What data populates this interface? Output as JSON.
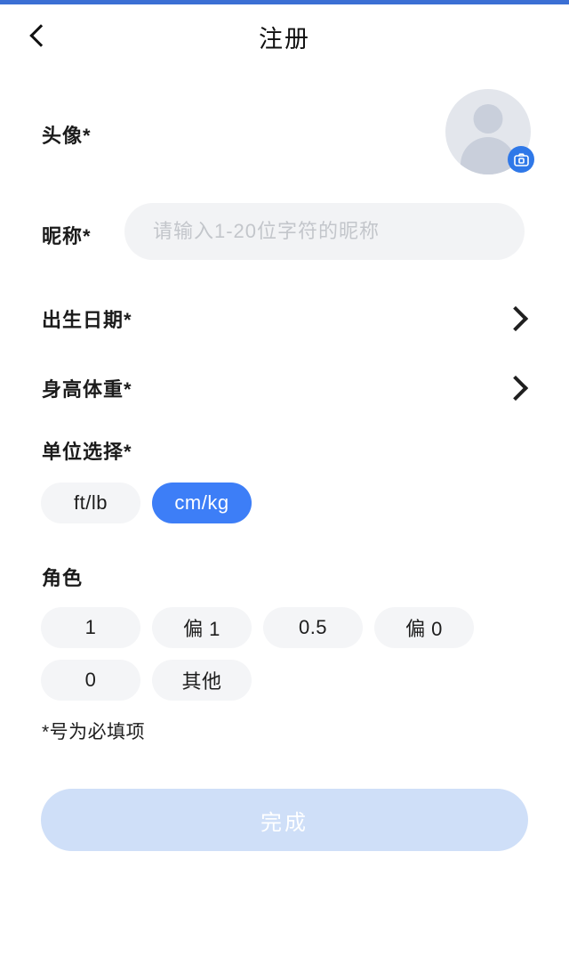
{
  "header": {
    "title": "注册",
    "back_icon": "chevron-left-icon"
  },
  "form": {
    "avatar": {
      "label": "头像*",
      "avatar_icon": "user-silhouette-icon",
      "camera_icon": "camera-icon"
    },
    "nickname": {
      "label": "昵称*",
      "value": "",
      "placeholder": "请输入1-20位字符的昵称"
    },
    "birthdate": {
      "label": "出生日期*",
      "chevron_icon": "chevron-right-icon"
    },
    "bodymetrics": {
      "label": "身高体重*",
      "chevron_icon": "chevron-right-icon"
    },
    "units": {
      "label": "单位选择*",
      "options": [
        {
          "label": "ft/lb",
          "selected": false
        },
        {
          "label": "cm/kg",
          "selected": true
        }
      ]
    },
    "role": {
      "label": "角色",
      "options": [
        {
          "label": "1",
          "selected": false
        },
        {
          "label": "偏 1",
          "selected": false
        },
        {
          "label": "0.5",
          "selected": false
        },
        {
          "label": "偏 0",
          "selected": false
        },
        {
          "label": "0",
          "selected": false
        },
        {
          "label": "其他",
          "selected": false
        }
      ]
    },
    "hint": "*号为必填项",
    "submit": {
      "label": "完成",
      "enabled": false
    }
  },
  "colors": {
    "status_bar": "#3b6fd4",
    "accent": "#3d7ef7",
    "pill_bg": "#f4f5f7",
    "input_bg": "#f2f3f5",
    "submit_disabled": "#cfdff8"
  }
}
